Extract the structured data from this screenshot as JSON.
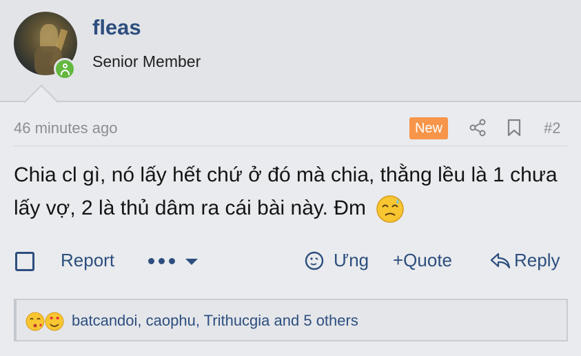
{
  "user": {
    "name": "fleas",
    "title": "Senior Member"
  },
  "post": {
    "timestamp": "46 minutes ago",
    "badge": "New",
    "number": "#2",
    "text": "Chia cl gì, nó lấy hết chứ ở đó mà chia, thằng lều là 1 chưa lấy vợ, 2 là thủ dâm ra cái bài này. Đm"
  },
  "actions": {
    "report": "Report",
    "react": "Ưng",
    "quote": "+Quote",
    "reply": "Reply"
  },
  "reactions": {
    "text": "batcandoi, caophu, Trithucgia and 5 others"
  },
  "colors": {
    "link": "#2d4e7e",
    "badge": "#f7954a",
    "online": "#63b83f"
  },
  "icons": [
    "share-icon",
    "bookmark-icon",
    "more-dots-icon",
    "react-icon",
    "reply-icon",
    "emoji-sweat",
    "emoji-kiss",
    "emoji-heart"
  ]
}
